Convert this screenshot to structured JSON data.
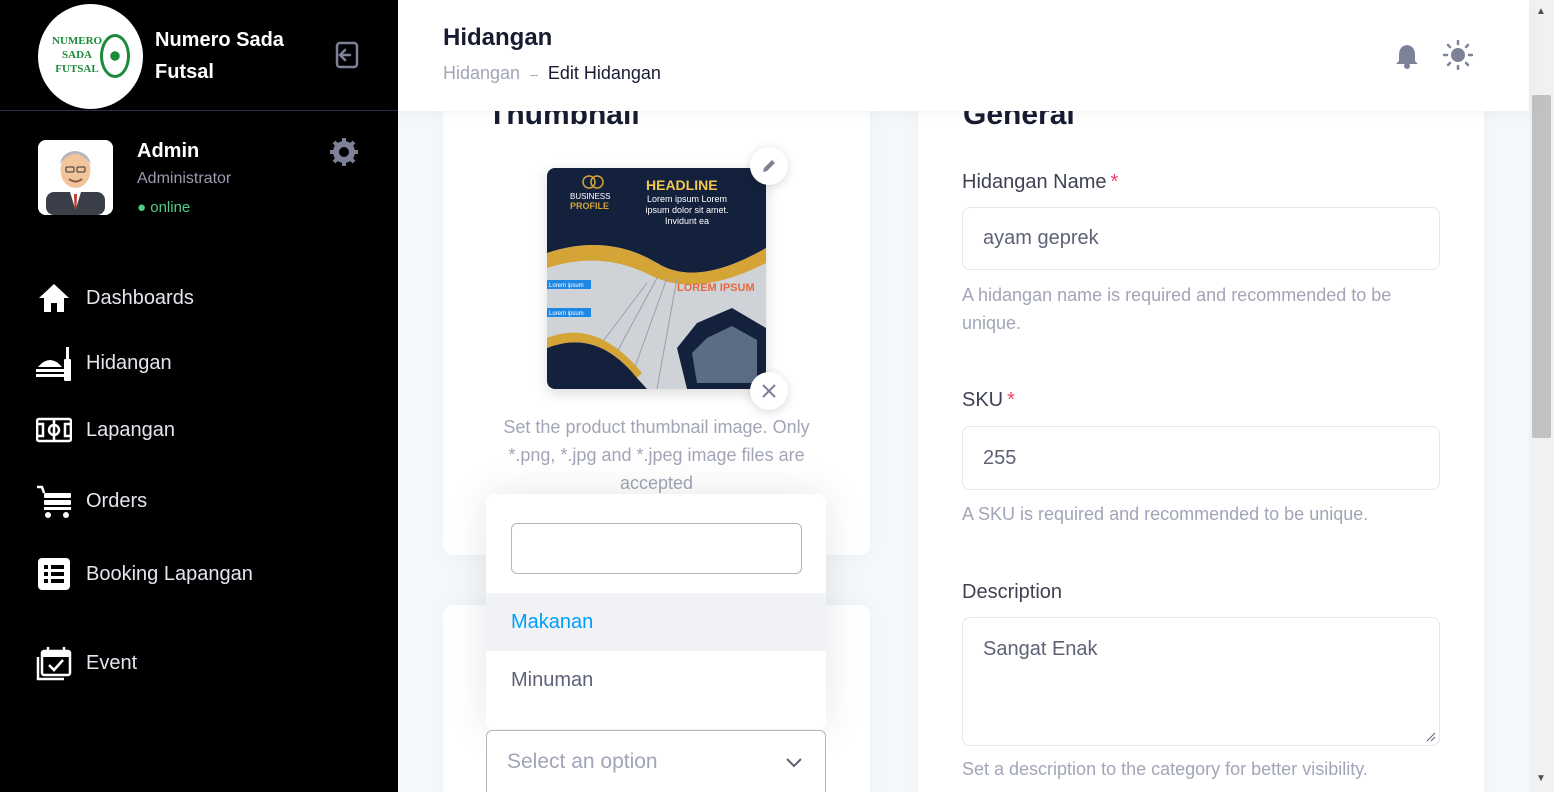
{
  "sidebar": {
    "brand_name": "Numero Sada Futsal",
    "logo_text": "NUMERO SADA FUTSAL",
    "user": {
      "name": "Admin",
      "role": "Administrator",
      "status": "online"
    },
    "items": [
      {
        "label": "Dashboards",
        "icon": "home-icon"
      },
      {
        "label": "Hidangan",
        "icon": "food-icon"
      },
      {
        "label": "Lapangan",
        "icon": "field-icon"
      },
      {
        "label": "Orders",
        "icon": "cart-icon"
      },
      {
        "label": "Booking Lapangan",
        "icon": "list-icon"
      },
      {
        "label": "Event",
        "icon": "calendar-icon"
      }
    ]
  },
  "header": {
    "title": "Hidangan",
    "breadcrumb": [
      "Hidangan",
      "Edit Hidangan"
    ]
  },
  "thumbnail": {
    "title": "Thumbnail",
    "image": {
      "headline": "HEADLINE",
      "brand_line1": "BUSINESS",
      "brand_line2": "PROFILE",
      "body": "Lorem ipsum Lorem ipsum dolor sit amet. Invidunt ea",
      "lorem_title": "LOREM IPSUM",
      "side1": "Lorem ipsum",
      "side2": "Lorem ipsum"
    },
    "hint": "Set the product thumbnail image. Only *.png, *.jpg and *.jpeg image files are accepted"
  },
  "category": {
    "search_value": "",
    "options": [
      "Makanan",
      "Minuman"
    ],
    "placeholder": "Select an option"
  },
  "general": {
    "title": "General",
    "name_label": "Hidangan Name",
    "name_value": "ayam geprek",
    "name_help": "A hidangan name is required and recommended to be unique.",
    "sku_label": "SKU",
    "sku_value": "255",
    "sku_help": "A SKU is required and recommended to be unique.",
    "desc_label": "Description",
    "desc_value": "Sangat Enak",
    "desc_help": "Set a description to the category for better visibility.",
    "required_mark": "*"
  },
  "colors": {
    "sidebar_bg": "#000000",
    "accent": "#009ef7",
    "required": "#f1416c",
    "online": "#50cd89"
  }
}
